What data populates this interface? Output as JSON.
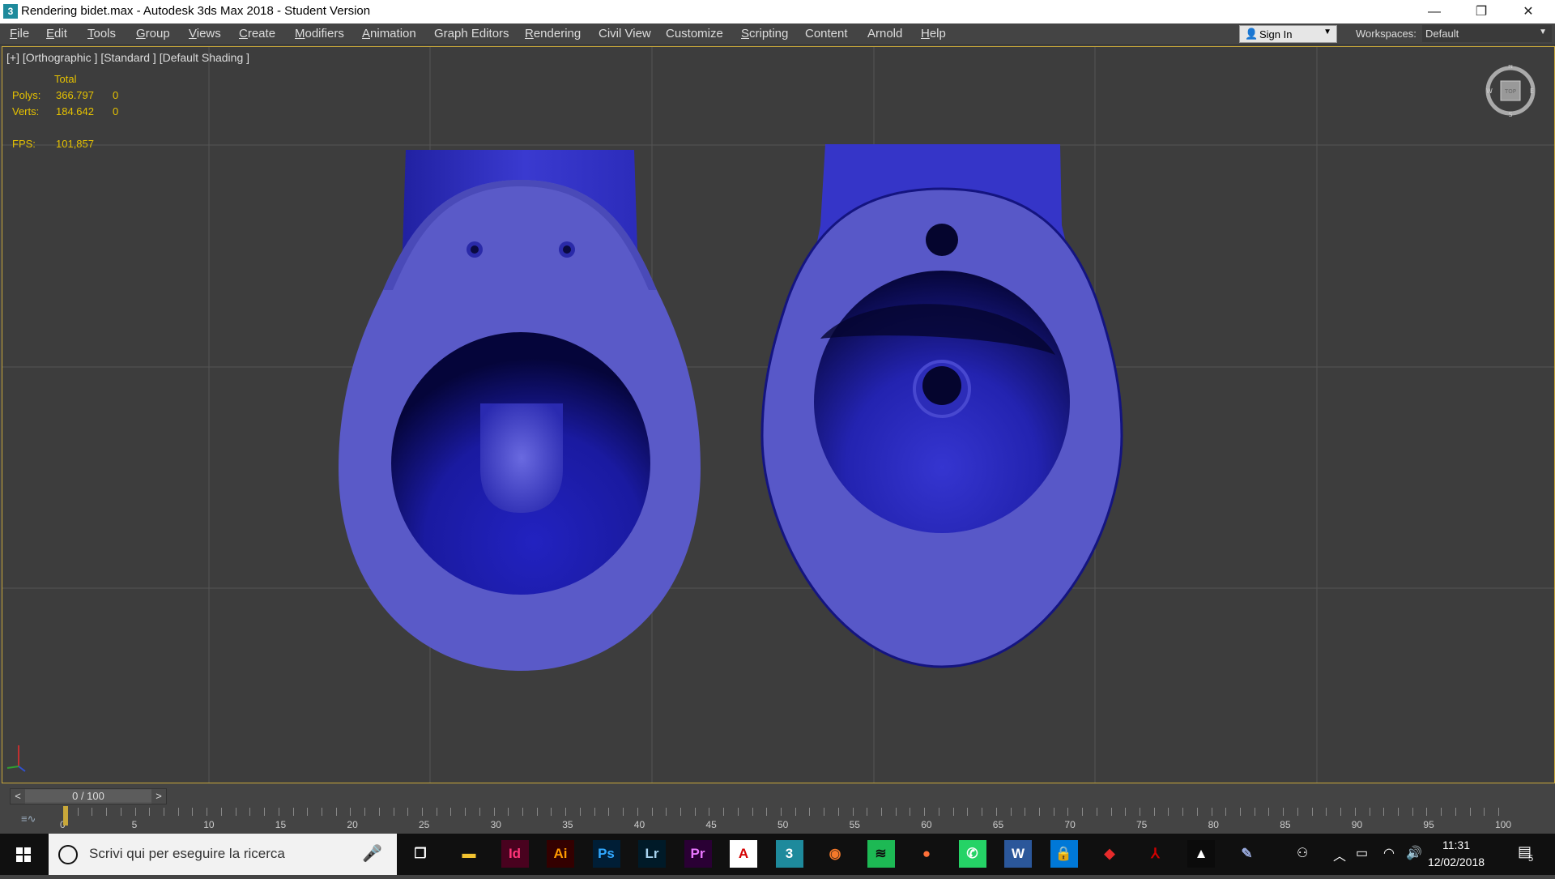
{
  "window": {
    "title": "Rendering bidet.max - Autodesk 3ds Max 2018 - Student Version",
    "app_icon": "3",
    "controls": [
      "—",
      "❐",
      "✕"
    ]
  },
  "menu": [
    {
      "u": "F",
      "rest": "ile"
    },
    {
      "u": "E",
      "rest": "dit"
    },
    {
      "u": "T",
      "rest": "ools"
    },
    {
      "u": "G",
      "rest": "roup"
    },
    {
      "u": "V",
      "rest": "iews"
    },
    {
      "u": "C",
      "rest": "reate"
    },
    {
      "u": "M",
      "rest": "odifiers"
    },
    {
      "u": "A",
      "rest": "nimation"
    },
    {
      "u": "",
      "rest": "Graph Editors"
    },
    {
      "u": "R",
      "rest": "endering"
    },
    {
      "u": "",
      "rest": "Civil View"
    },
    {
      "u": "",
      "rest": "Customize"
    },
    {
      "u": "S",
      "rest": "cripting"
    },
    {
      "u": "",
      "rest": "Content"
    },
    {
      "u": "",
      "rest": "Arnold"
    },
    {
      "u": "H",
      "rest": "elp"
    }
  ],
  "account": {
    "sign_in": "Sign In",
    "workspaces_label": "Workspaces:",
    "workspace": "Default"
  },
  "viewport": {
    "label": "[+] [Orthographic ] [Standard ] [Default Shading ]",
    "stats": {
      "header": "Total",
      "polys_label": "Polys:",
      "polys": "366.797",
      "polys_sel": "0",
      "verts_label": "Verts:",
      "verts": "184.642",
      "verts_sel": "0",
      "fps_label": "FPS:",
      "fps": "101,857"
    },
    "compass": {
      "n": "N",
      "s": "S",
      "w": "W",
      "e": "E",
      "face": "TOP"
    },
    "model_color": "#5a5ad0"
  },
  "timeline": {
    "slider": "0 / 100",
    "prev": "<",
    "next": ">",
    "labels": [
      "0",
      "5",
      "10",
      "15",
      "20",
      "25",
      "30",
      "35",
      "40",
      "45",
      "50",
      "55",
      "60",
      "65",
      "70",
      "75",
      "80",
      "85",
      "90",
      "95",
      "100"
    ]
  },
  "taskbar": {
    "search_placeholder": "Scrivi qui per eseguire la ricerca",
    "apps": [
      {
        "name": "file-explorer-icon",
        "glyph": "▬",
        "color": "#f2c230",
        "bg": "transparent"
      },
      {
        "name": "indesign-icon",
        "glyph": "Id",
        "color": "#ff3478",
        "bg": "#49021f"
      },
      {
        "name": "illustrator-icon",
        "glyph": "Ai",
        "color": "#ff9a00",
        "bg": "#330000"
      },
      {
        "name": "photoshop-icon",
        "glyph": "Ps",
        "color": "#31a8ff",
        "bg": "#001e36"
      },
      {
        "name": "lightroom-icon",
        "glyph": "Lr",
        "color": "#a8d4f0",
        "bg": "#001a28"
      },
      {
        "name": "premiere-icon",
        "glyph": "Pr",
        "color": "#ea77ff",
        "bg": "#2a0034"
      },
      {
        "name": "acrobat-icon",
        "glyph": "A",
        "color": "#d40000",
        "bg": "#ffffff"
      },
      {
        "name": "3dsmax-icon",
        "glyph": "3",
        "color": "#ffffff",
        "bg": "#1e8a9c"
      },
      {
        "name": "blender-icon",
        "glyph": "◉",
        "color": "#f5792a",
        "bg": "transparent"
      },
      {
        "name": "spotify-icon",
        "glyph": "≋",
        "color": "#101010",
        "bg": "#1db954"
      },
      {
        "name": "firefox-icon",
        "glyph": "●",
        "color": "#ff7139",
        "bg": "transparent"
      },
      {
        "name": "whatsapp-icon",
        "glyph": "✆",
        "color": "#ffffff",
        "bg": "#25d366"
      },
      {
        "name": "word-icon",
        "glyph": "W",
        "color": "#ffffff",
        "bg": "#2b579a"
      },
      {
        "name": "store-lock-icon",
        "glyph": "🔒",
        "color": "#ffffff",
        "bg": "#0078d7"
      },
      {
        "name": "sketchup-icon",
        "glyph": "◆",
        "color": "#e72b2b",
        "bg": "transparent"
      },
      {
        "name": "acrobat-reader-icon",
        "glyph": "⅄",
        "color": "#d40000",
        "bg": "transparent"
      },
      {
        "name": "photos-icon",
        "glyph": "▲",
        "color": "#ffffff",
        "bg": "#0b0b0b"
      },
      {
        "name": "paint-icon",
        "glyph": "✎",
        "color": "#9ad",
        "bg": "transparent"
      }
    ],
    "time": "11:31",
    "date": "12/02/2018",
    "notifications": "5"
  }
}
